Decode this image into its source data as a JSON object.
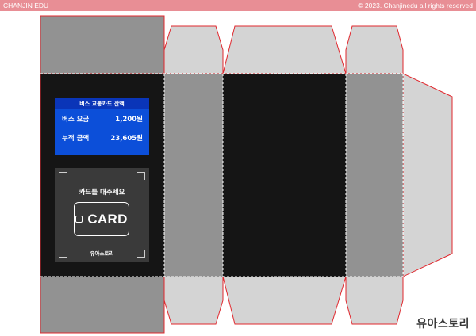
{
  "header": {
    "left_text": "CHANJIN EDU",
    "right_text": "© 2023. Chanjinedu all rights reserved",
    "color": "#e88e95"
  },
  "panel": {
    "title": "버스 교통카드 잔액",
    "rows": [
      {
        "label": "버스 요금",
        "value": "1,200원"
      },
      {
        "label": "누적 금액",
        "value": "23,605원"
      }
    ],
    "color": "#0c4fd9"
  },
  "reader": {
    "prompt": "카드를 대주세요",
    "card_label": "CARD",
    "logo": "유아스토리"
  },
  "brand_logo": "유아스토리",
  "colors": {
    "cut_line": "#e0282e",
    "fold_line": "#ffffff",
    "light_gray": "#d4d4d4",
    "mid_gray": "#929292",
    "dark": "#151515"
  }
}
